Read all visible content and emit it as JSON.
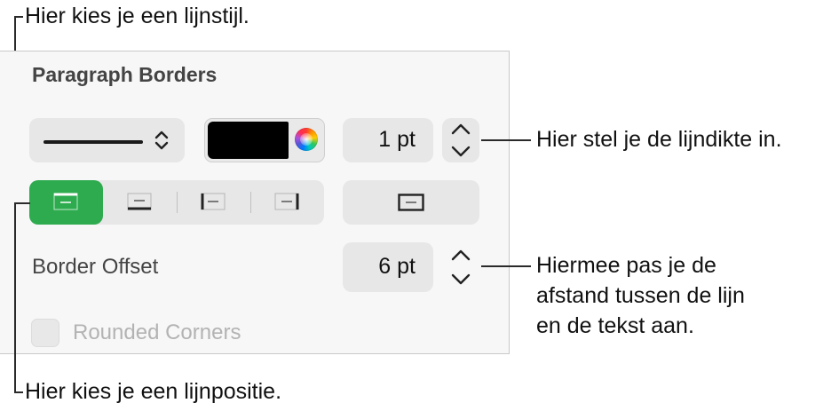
{
  "callouts": {
    "line_style": "Hier kies je een lijnstijl.",
    "line_width": "Hier stel je de lijndikte in.",
    "offset_line1": "Hiermee pas je de",
    "offset_line2": "afstand tussen de lijn",
    "offset_line3": "en de tekst aan.",
    "position": "Hier kies je een lijnpositie."
  },
  "panel": {
    "title": "Paragraph Borders",
    "line_style": {
      "selected": "solid",
      "icon": "updown-chevron-icon"
    },
    "color_well": {
      "color": "#000000",
      "icon": "color-wheel-icon"
    },
    "width_field": {
      "value": "1 pt"
    },
    "border_positions": [
      {
        "name": "top",
        "selected": true
      },
      {
        "name": "bottom",
        "selected": false
      },
      {
        "name": "left",
        "selected": false
      },
      {
        "name": "right",
        "selected": false
      }
    ],
    "border_all": {
      "name": "box"
    },
    "border_offset": {
      "label": "Border Offset",
      "value": "6 pt"
    },
    "rounded_corners": {
      "label": "Rounded Corners",
      "checked": false,
      "enabled": false
    }
  },
  "colors": {
    "accent": "#2eab4f",
    "panel_bg": "#f7f7f7",
    "control_bg": "#e7e7e7"
  }
}
